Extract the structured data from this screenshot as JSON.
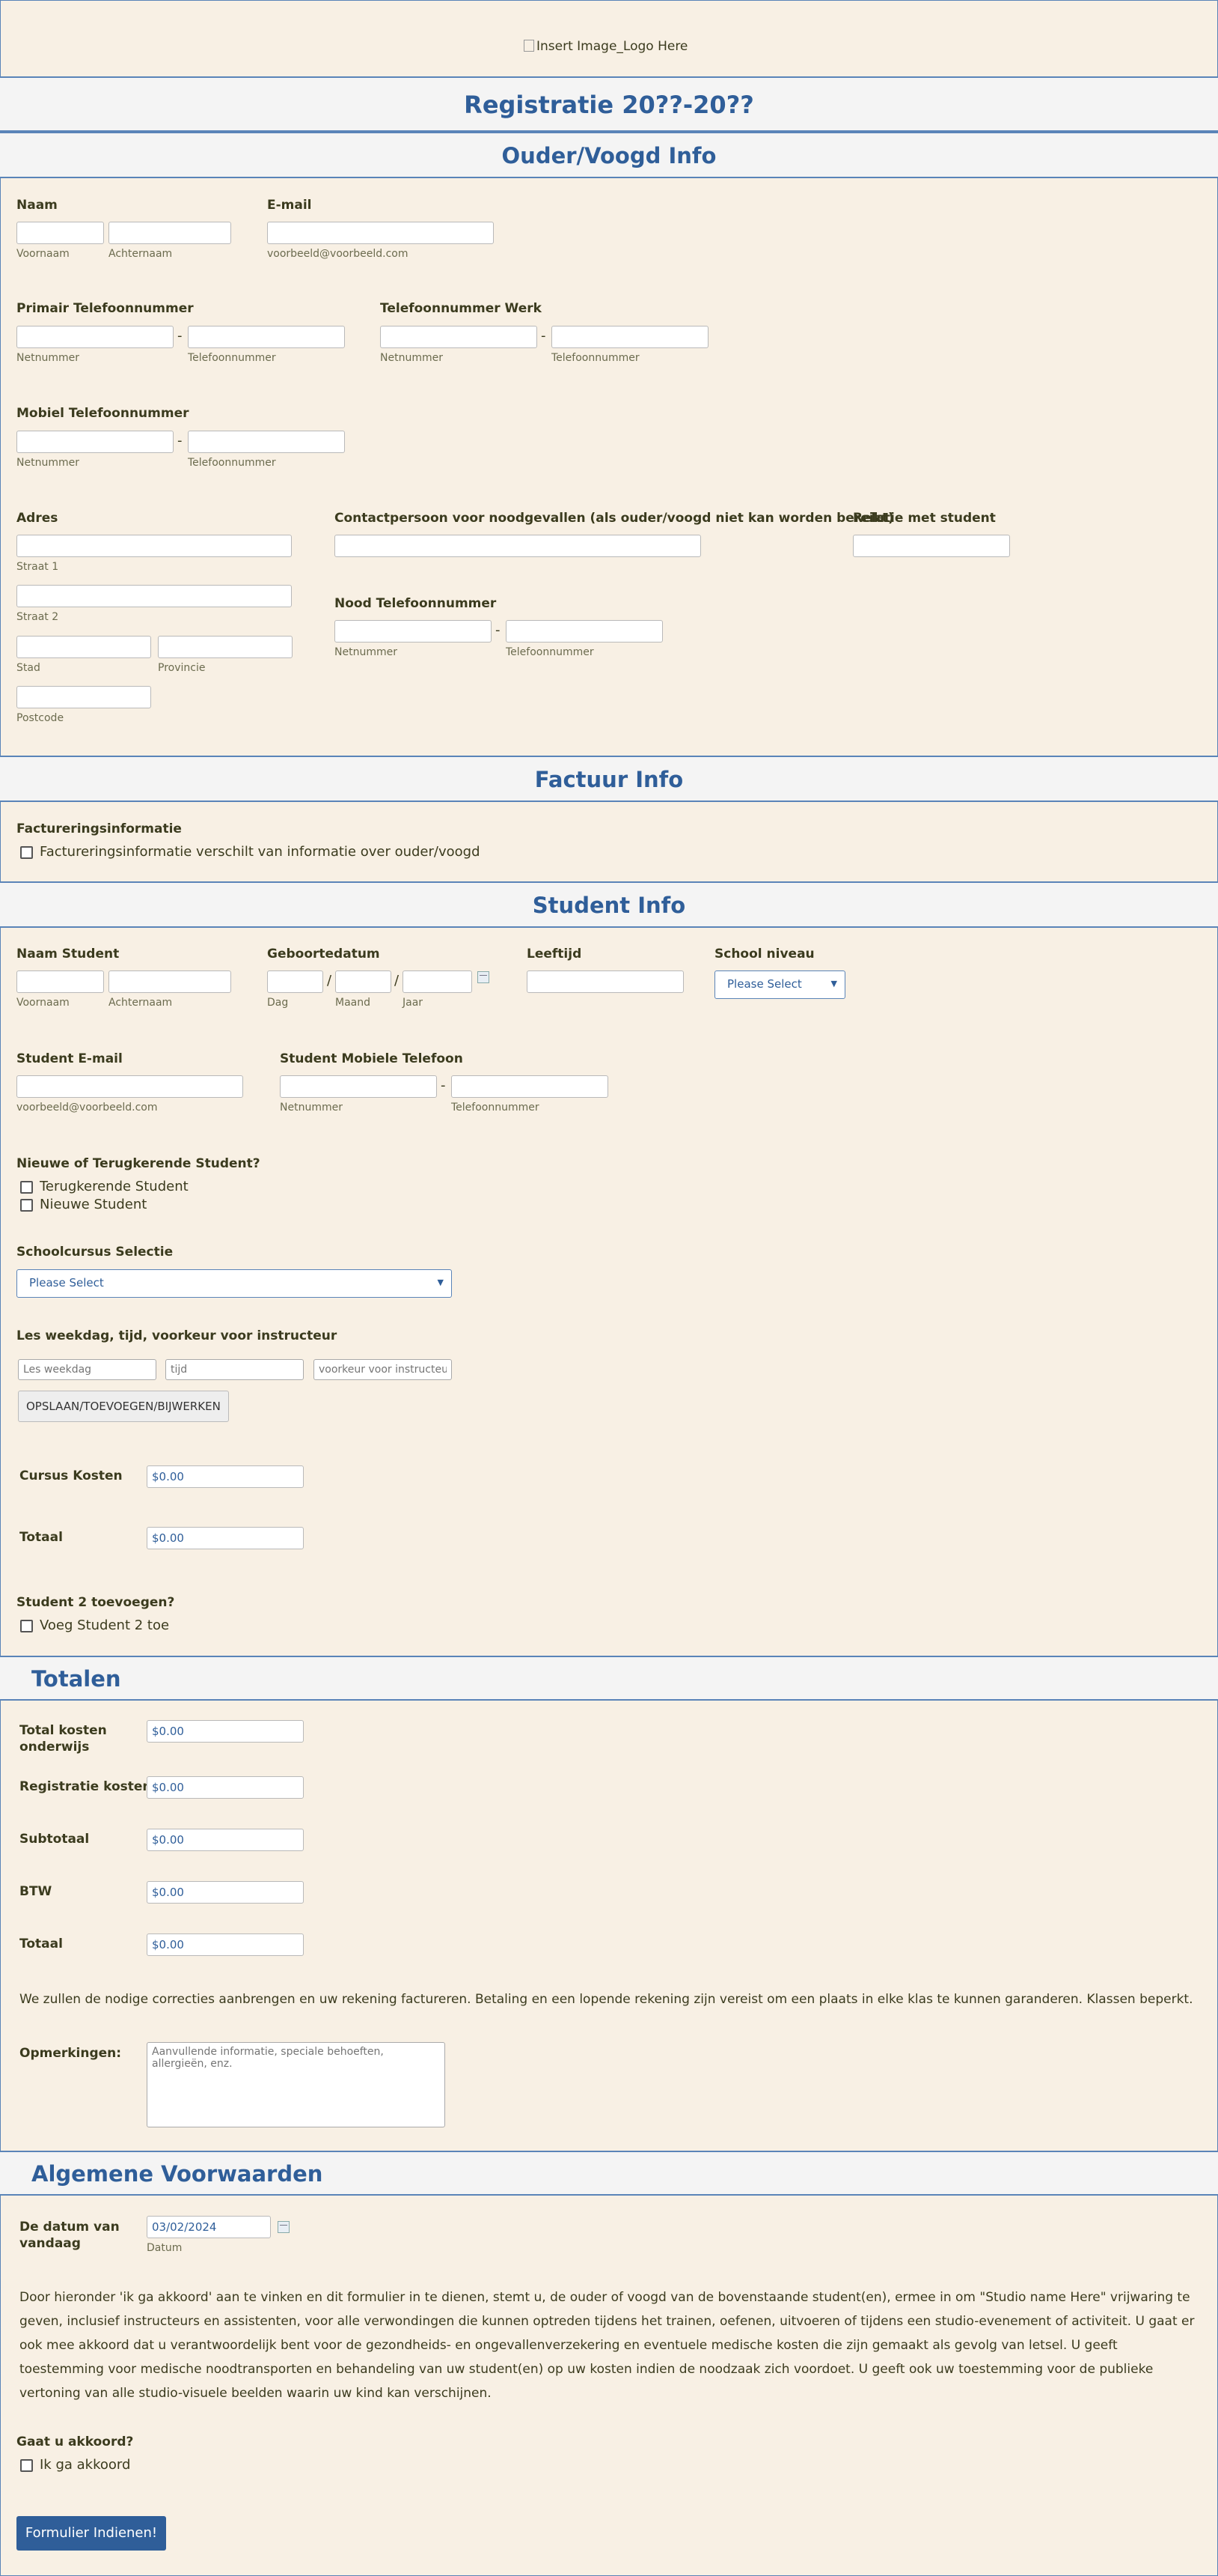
{
  "logo": {
    "alt": "Insert Image_Logo Here"
  },
  "header": {
    "title": "Registratie 20??-20??"
  },
  "parent_section": {
    "title": "Ouder/Voogd Info",
    "naam_label": "Naam",
    "voornaam_sub": "Voornaam",
    "achternaam_sub": "Achternaam",
    "email_label": "E-mail",
    "email_sub": "voorbeeld@voorbeeld.com",
    "primair_label": "Primair Telefoonnummer",
    "werk_label": "Telefoonnummer Werk",
    "mobiel_label": "Mobiel Telefoonnummer",
    "netnummer_sub": "Netnummer",
    "telefoonnummer_sub": "Telefoonnummer",
    "adres_label": "Adres",
    "straat1_sub": "Straat 1",
    "straat2_sub": "Straat 2",
    "stad_sub": "Stad",
    "provincie_sub": "Provincie",
    "postcode_sub": "Postcode",
    "contact_label": "Contactpersoon voor noodgevallen (als ouder/voogd niet kan worden bereikt)",
    "relatie_label": "Relatie met student",
    "nood_label": "Nood Telefoonnummer",
    "dash": "-"
  },
  "factuur_section": {
    "title": "Factuur Info",
    "label": "Factureringsinformatie",
    "checkbox": "Factureringsinformatie verschilt van informatie over ouder/voogd"
  },
  "student_section": {
    "title": "Student Info",
    "naam_label": "Naam Student",
    "voornaam_sub": "Voornaam",
    "achternaam_sub": "Achternaam",
    "geboorte_label": "Geboortedatum",
    "dag_sub": "Dag",
    "maand_sub": "Maand",
    "jaar_sub": "Jaar",
    "slash": "/",
    "leeftijd_label": "Leeftijd",
    "niveau_label": "School niveau",
    "niveau_value": "Please Select",
    "email_label": "Student E-mail",
    "email_sub": "voorbeeld@voorbeeld.com",
    "mobiel_label": "Student Mobiele Telefoon",
    "netnummer_sub": "Netnummer",
    "telefoonnummer_sub": "Telefoonnummer",
    "nieuw_label": "Nieuwe of Terugkerende Student?",
    "terug_option": "Terugkerende Student",
    "nieuw_option": "Nieuwe Student",
    "cursus_label": "Schoolcursus Selectie",
    "cursus_value": "Please Select",
    "les_label": "Les weekdag, tijd, voorkeur voor instructeur",
    "les_weekdag_ph": "Les weekdag",
    "les_tijd_ph": "tijd",
    "les_instructeur_ph": "voorkeur voor instructeur",
    "save_button": "OPSLAAN/TOEVOEGEN/BIJWERKEN",
    "kosten_label": "Cursus Kosten",
    "kosten_value": "$0.00",
    "totaal_label": "Totaal",
    "totaal_value": "$0.00",
    "student2_label": "Student 2 toevoegen?",
    "student2_option": "Voeg Student 2 toe"
  },
  "totalen_section": {
    "title": "Totalen",
    "onderwijs_label": "Total kosten onderwijs",
    "onderwijs_value": "$0.00",
    "registratie_label": "Registratie kosten",
    "registratie_value": "$0.00",
    "subtotaal_label": "Subtotaal",
    "subtotaal_value": "$0.00",
    "btw_label": "BTW",
    "btw_value": "$0.00",
    "totaal_label": "Totaal",
    "totaal_value": "$0.00",
    "note": "We zullen de nodige correcties aanbrengen en uw rekening factureren. Betaling en een lopende rekening zijn vereist om een plaats in elke klas te kunnen garanderen. Klassen beperkt.",
    "opmerkingen_label": "Opmerkingen:",
    "opmerkingen_ph": "Aanvullende informatie, speciale behoeften, allergieën, enz."
  },
  "voorwaarden_section": {
    "title": "Algemene Voorwaarden",
    "datum_label": "De datum van vandaag",
    "datum_value": "03/02/2024",
    "datum_sub": "Datum",
    "terms": "Door hieronder 'ik ga akkoord' aan te vinken en dit formulier in te dienen, stemt u, de ouder of voogd van de bovenstaande student(en), ermee in om \"Studio name Here\" vrijwaring te geven, inclusief instructeurs en assistenten, voor alle verwondingen die kunnen optreden tijdens het trainen, oefenen, uitvoeren of tijdens een studio-evenement of activiteit. U gaat er ook mee akkoord dat u verantwoordelijk bent voor de gezondheids- en ongevallenverzekering en eventuele medische kosten die zijn gemaakt als gevolg van letsel. U geeft toestemming voor medische noodtransporten en behandeling van uw student(en) op uw kosten indien de noodzaak zich voordoet. U geeft ook uw toestemming voor de publieke vertoning van alle studio-visuele beelden waarin uw kind kan verschijnen.",
    "akkoord_label": "Gaat u akkoord?",
    "akkoord_option": "Ik ga akkoord",
    "submit": "Formulier Indienen!"
  }
}
